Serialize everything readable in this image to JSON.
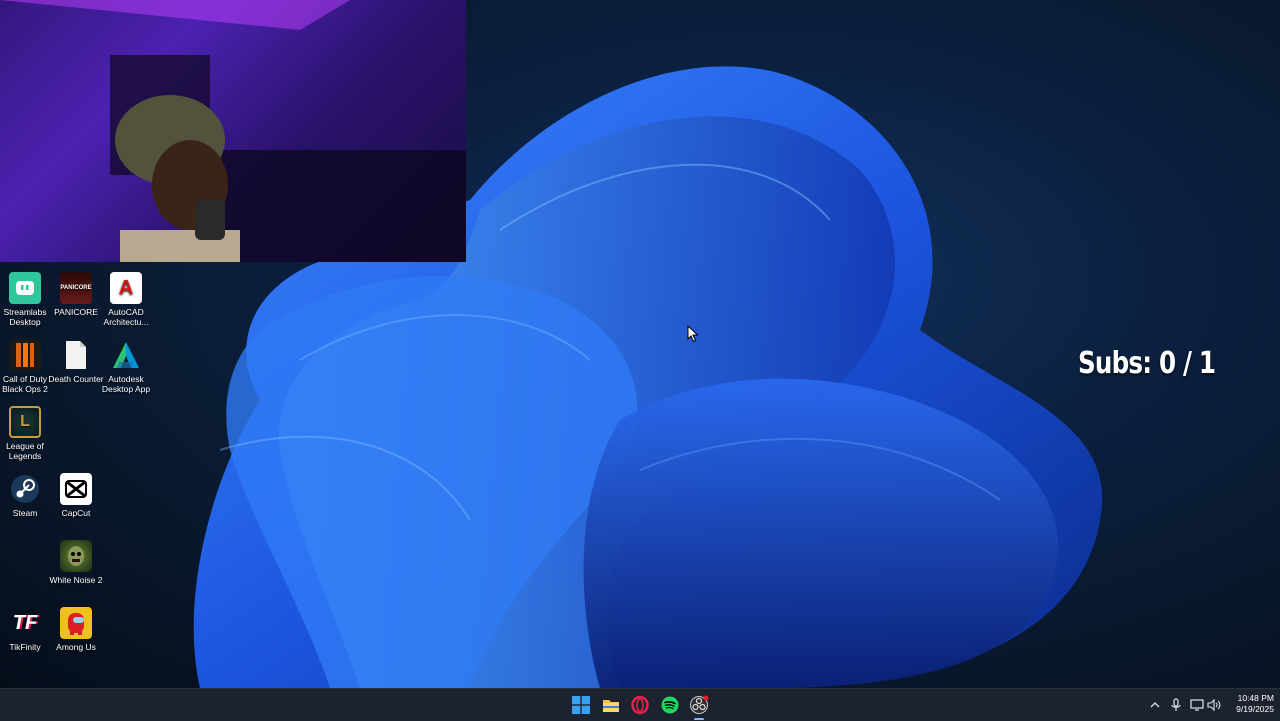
{
  "desktop_icons": [
    {
      "label": "Streamlabs Desktop",
      "icon": "streamlabs-icon",
      "color": "#30c79c"
    },
    {
      "label": "PANICORE",
      "icon": "panicore-icon",
      "color": "#4a1010"
    },
    {
      "label": "AutoCAD Architectu...",
      "icon": "autocad-icon",
      "color": "#ffffff"
    },
    {
      "label": "Call of Duty Black Ops 2",
      "icon": "call-of-duty-icon",
      "color": "#e06010"
    },
    {
      "label": "Death Counter",
      "icon": "text-file-icon",
      "color": "#f2f2f2"
    },
    {
      "label": "Autodesk Desktop App",
      "icon": "autodesk-icon",
      "color": "#1aa0c8"
    },
    {
      "label": "League of Legends",
      "icon": "league-of-legends-icon",
      "color": "#c89b3c"
    },
    {
      "label": "Steam",
      "icon": "steam-icon",
      "color": "#1b2838"
    },
    {
      "label": "CapCut",
      "icon": "capcut-icon",
      "color": "#000000"
    },
    {
      "label": "White Noise 2",
      "icon": "white-noise-icon",
      "color": "#3a5a2a"
    },
    {
      "label": "TikFinity",
      "icon": "tikfinity-icon",
      "color": "#ffffff"
    },
    {
      "label": "Among Us",
      "icon": "among-us-icon",
      "color": "#d82020"
    }
  ],
  "overlay": {
    "subs_counter": "Subs:  0 / 1"
  },
  "taskbar": {
    "apps": [
      {
        "name": "start",
        "icon": "windows-start-icon"
      },
      {
        "name": "file-explorer",
        "icon": "folder-icon"
      },
      {
        "name": "opera-gx",
        "icon": "opera-icon"
      },
      {
        "name": "spotify",
        "icon": "spotify-icon"
      },
      {
        "name": "obs",
        "icon": "obs-icon"
      }
    ],
    "tray": {
      "time": "10:48 PM",
      "date": "9/19/2025"
    }
  },
  "colors": {
    "taskbar_bg": "#1c2230",
    "wallpaper_blue": "#1e5be0",
    "webcam_purple": "#5a2ad0"
  }
}
